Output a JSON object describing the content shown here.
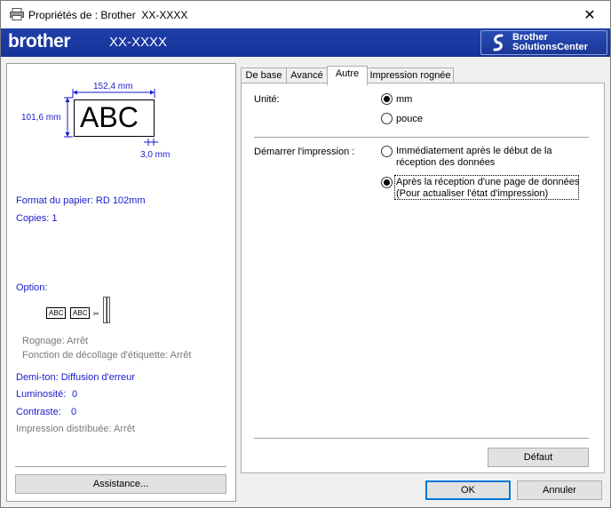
{
  "window": {
    "title": "Propriétés de : Brother  XX-XXXX"
  },
  "brand": {
    "logo": "brother",
    "model": "XX-XXXX",
    "solutions_line1": "Brother",
    "solutions_line2": "SolutionsCenter"
  },
  "preview": {
    "width_dim": "152,4 mm",
    "height_dim": "101,6 mm",
    "label_text": "ABC",
    "margin_dim": "3,0 mm",
    "paper_format": "Format du papier: RD 102mm",
    "copies": "Copies: 1",
    "option_heading": "Option:",
    "option_label1": "ABC",
    "option_label2": "ABC",
    "cutting": "Rognage: Arrêt",
    "peel": "Fonction de décollage d'étiquette: Arrêt",
    "halftone": "Demi-ton: Diffusion d'erreur",
    "brightness_label": "Luminosité:",
    "brightness_value": "0",
    "contrast_label": "Contraste:",
    "contrast_value": "0",
    "distributed": "Impression distribuée: Arrêt",
    "assist_button": "Assistance..."
  },
  "tabs": [
    {
      "label": "De base",
      "active": false
    },
    {
      "label": "Avancé",
      "active": false
    },
    {
      "label": "Autre",
      "active": true
    },
    {
      "label": "Impression rognée",
      "active": false
    }
  ],
  "autre": {
    "unit_label": "Unité:",
    "unit_options": [
      {
        "label": "mm",
        "checked": true
      },
      {
        "label": "pouce",
        "checked": false
      }
    ],
    "start_label": "Démarrer l'impression :",
    "start_options": [
      {
        "line1": "Immédiatement après le début de la",
        "line2": "réception des données",
        "checked": false
      },
      {
        "line1": "Après la réception d'une page de données",
        "line2": "(Pour actualiser l'état d'impression)",
        "checked": true
      }
    ],
    "default_button": "Défaut"
  },
  "footer": {
    "ok": "OK",
    "cancel": "Annuler"
  },
  "colors": {
    "brand_blue": "#1f3fa8",
    "info_blue": "#1a1acc"
  }
}
